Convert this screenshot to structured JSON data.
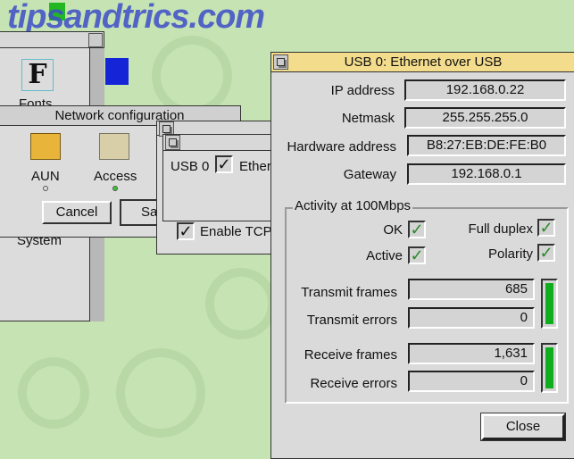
{
  "watermark": "tipsandtrics.com",
  "filer_window": {
    "icon_label": "Fonts",
    "partial_item": "System"
  },
  "netconfig": {
    "title": "Network configuration",
    "items": [
      {
        "label": "AUN",
        "status": "off"
      },
      {
        "label": "Access",
        "status": "on"
      }
    ],
    "cancel": "Cancel",
    "save_partial": "Sa"
  },
  "interfaces": {
    "usb_label": "USB 0",
    "usb_checked": true,
    "ether_partial": "Ether",
    "enable_tcp": "Enable TCP",
    "tcp_checked": true
  },
  "usb_window": {
    "title": "USB 0: Ethernet over USB",
    "fields": [
      {
        "label": "IP address",
        "value": "192.168.0.22"
      },
      {
        "label": "Netmask",
        "value": "255.255.255.0"
      },
      {
        "label": "Hardware address",
        "value": "B8:27:EB:DE:FE:B0"
      },
      {
        "label": "Gateway",
        "value": "192.168.0.1"
      }
    ],
    "activity": {
      "title": "Activity at 100Mbps",
      "ok": {
        "label": "OK",
        "checked": true
      },
      "active": {
        "label": "Active",
        "checked": true
      },
      "full_duplex": {
        "label": "Full duplex",
        "checked": true
      },
      "polarity": {
        "label": "Polarity",
        "checked": true
      },
      "transmit_frames": {
        "label": "Transmit frames",
        "value": "685"
      },
      "transmit_errors": {
        "label": "Transmit errors",
        "value": "0"
      },
      "receive_frames": {
        "label": "Receive frames",
        "value": "1,631"
      },
      "receive_errors": {
        "label": "Receive errors",
        "value": "0"
      },
      "transmit_level": 1.0,
      "receive_level": 1.0
    },
    "close": "Close"
  },
  "colors": {
    "title_active": "#f3dc8c",
    "desktop": "#c6e3b4",
    "activity_bar": "#0fae1f"
  }
}
